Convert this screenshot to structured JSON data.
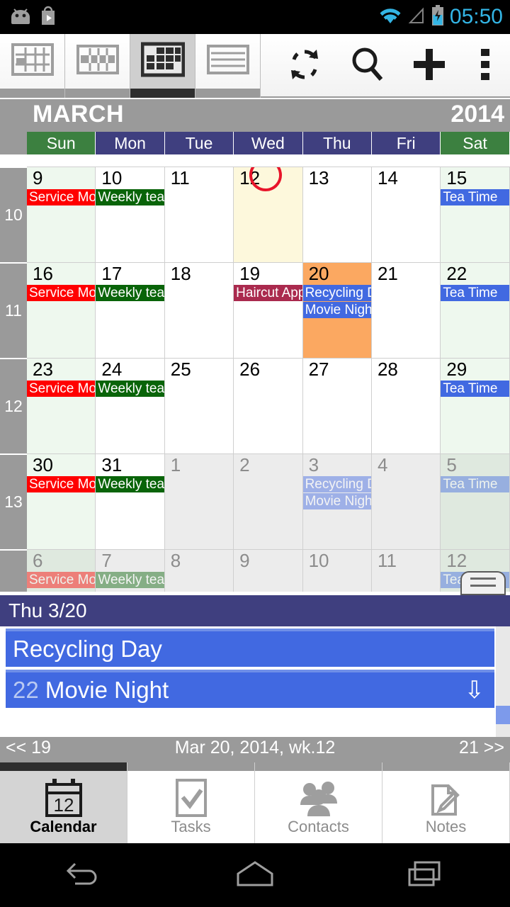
{
  "status_bar": {
    "time": "05:50",
    "icons": [
      "android-robot-icon",
      "play-store-icon",
      "wifi-icon",
      "signal-icon",
      "battery-charging-icon"
    ]
  },
  "toolbar": {
    "view_buttons": [
      {
        "name": "day-view-icon",
        "label": "Day view",
        "active": false
      },
      {
        "name": "week-view-icon",
        "label": "Week view",
        "active": false
      },
      {
        "name": "month-view-icon",
        "label": "Month view",
        "active": true
      },
      {
        "name": "agenda-view-icon",
        "label": "Agenda view",
        "active": false
      }
    ],
    "actions": [
      {
        "name": "sync-icon",
        "label": "Sync"
      },
      {
        "name": "search-icon",
        "label": "Search"
      },
      {
        "name": "add-icon",
        "label": "Add event"
      },
      {
        "name": "overflow-menu-icon",
        "label": "More options"
      }
    ]
  },
  "month_header": {
    "month": "MARCH",
    "year": "2014"
  },
  "day_headers": [
    {
      "label": "Sun",
      "weekend": true
    },
    {
      "label": "Mon",
      "weekend": false
    },
    {
      "label": "Tue",
      "weekend": false
    },
    {
      "label": "Wed",
      "weekend": false
    },
    {
      "label": "Thu",
      "weekend": false
    },
    {
      "label": "Fri",
      "weekend": false
    },
    {
      "label": "Sat",
      "weekend": true
    }
  ],
  "colors": {
    "event_red": "#ff0000",
    "event_green": "#096409",
    "event_blue": "#4169e1",
    "event_maroon": "#aa2a4e",
    "selected_day": "#fba861",
    "today_bg": "#fdf8dc",
    "today_circle": "#e8152a",
    "header_weekday": "#3f3f7f",
    "header_weekend": "#3c8040",
    "weeknum_bg": "#9a9a9a"
  },
  "weeks": [
    {
      "week_number": "10",
      "days": [
        {
          "num": "9",
          "weekend": "sun",
          "other": false,
          "today": false,
          "selected": false,
          "events": [
            {
              "title": "Service Mon",
              "color": "#ff0000"
            }
          ]
        },
        {
          "num": "10",
          "weekend": "",
          "other": false,
          "today": false,
          "selected": false,
          "events": [
            {
              "title": "Weekly tean",
              "color": "#096409"
            }
          ]
        },
        {
          "num": "11",
          "weekend": "",
          "other": false,
          "today": false,
          "selected": false,
          "events": []
        },
        {
          "num": "12",
          "weekend": "",
          "other": false,
          "today": true,
          "selected": false,
          "events": []
        },
        {
          "num": "13",
          "weekend": "",
          "other": false,
          "today": false,
          "selected": false,
          "events": []
        },
        {
          "num": "14",
          "weekend": "",
          "other": false,
          "today": false,
          "selected": false,
          "events": []
        },
        {
          "num": "15",
          "weekend": "sat",
          "other": false,
          "today": false,
          "selected": false,
          "events": [
            {
              "title": "Tea Time",
              "color": "#4169e1"
            }
          ]
        }
      ]
    },
    {
      "week_number": "11",
      "days": [
        {
          "num": "16",
          "weekend": "sun",
          "other": false,
          "today": false,
          "selected": false,
          "events": [
            {
              "title": "Service Mon",
              "color": "#ff0000"
            }
          ]
        },
        {
          "num": "17",
          "weekend": "",
          "other": false,
          "today": false,
          "selected": false,
          "events": [
            {
              "title": "Weekly tean",
              "color": "#096409"
            }
          ]
        },
        {
          "num": "18",
          "weekend": "",
          "other": false,
          "today": false,
          "selected": false,
          "events": []
        },
        {
          "num": "19",
          "weekend": "",
          "other": false,
          "today": false,
          "selected": false,
          "events": [
            {
              "title": "Haircut App",
              "color": "#aa2a4e"
            }
          ]
        },
        {
          "num": "20",
          "weekend": "",
          "other": false,
          "today": false,
          "selected": true,
          "events": [
            {
              "title": "Recycling D",
              "color": "#4169e1"
            },
            {
              "title": "Movie Night",
              "color": "#4169e1",
              "span": 2
            }
          ]
        },
        {
          "num": "21",
          "weekend": "",
          "other": false,
          "today": false,
          "selected": false,
          "events": []
        },
        {
          "num": "22",
          "weekend": "sat",
          "other": false,
          "today": false,
          "selected": false,
          "events": [
            {
              "title": "Tea Time",
              "color": "#4169e1"
            }
          ]
        }
      ]
    },
    {
      "week_number": "12",
      "days": [
        {
          "num": "23",
          "weekend": "sun",
          "other": false,
          "today": false,
          "selected": false,
          "events": [
            {
              "title": "Service Mon",
              "color": "#ff0000"
            }
          ]
        },
        {
          "num": "24",
          "weekend": "",
          "other": false,
          "today": false,
          "selected": false,
          "events": [
            {
              "title": "Weekly tean",
              "color": "#096409"
            }
          ]
        },
        {
          "num": "25",
          "weekend": "",
          "other": false,
          "today": false,
          "selected": false,
          "events": []
        },
        {
          "num": "26",
          "weekend": "",
          "other": false,
          "today": false,
          "selected": false,
          "events": []
        },
        {
          "num": "27",
          "weekend": "",
          "other": false,
          "today": false,
          "selected": false,
          "events": []
        },
        {
          "num": "28",
          "weekend": "",
          "other": false,
          "today": false,
          "selected": false,
          "events": []
        },
        {
          "num": "29",
          "weekend": "sat",
          "other": false,
          "today": false,
          "selected": false,
          "events": [
            {
              "title": "Tea Time",
              "color": "#4169e1"
            }
          ]
        }
      ]
    },
    {
      "week_number": "13",
      "days": [
        {
          "num": "30",
          "weekend": "sun",
          "other": false,
          "today": false,
          "selected": false,
          "events": [
            {
              "title": "Service Mon",
              "color": "#ff0000"
            }
          ]
        },
        {
          "num": "31",
          "weekend": "",
          "other": false,
          "today": false,
          "selected": false,
          "events": [
            {
              "title": "Weekly tean",
              "color": "#096409"
            }
          ]
        },
        {
          "num": "1",
          "weekend": "",
          "other": true,
          "today": false,
          "selected": false,
          "events": []
        },
        {
          "num": "2",
          "weekend": "",
          "other": true,
          "today": false,
          "selected": false,
          "events": []
        },
        {
          "num": "3",
          "weekend": "",
          "other": true,
          "today": false,
          "selected": false,
          "events": [
            {
              "title": "Recycling D",
              "color": "#4169e1",
              "faded": true
            },
            {
              "title": "Movie Night",
              "color": "#4169e1",
              "faded": true
            }
          ]
        },
        {
          "num": "4",
          "weekend": "",
          "other": true,
          "today": false,
          "selected": false,
          "events": []
        },
        {
          "num": "5",
          "weekend": "sat",
          "other": true,
          "today": false,
          "selected": false,
          "events": [
            {
              "title": "Tea Time",
              "color": "#4169e1",
              "faded": true
            }
          ]
        }
      ]
    },
    {
      "week_number": "",
      "short": true,
      "days": [
        {
          "num": "6",
          "weekend": "sun",
          "other": true,
          "today": false,
          "selected": false,
          "events": [
            {
              "title": "Service Mon",
              "color": "#ff0000",
              "faded": true
            }
          ]
        },
        {
          "num": "7",
          "weekend": "",
          "other": true,
          "today": false,
          "selected": false,
          "events": [
            {
              "title": "Weekly tean",
              "color": "#096409",
              "faded": true
            }
          ]
        },
        {
          "num": "8",
          "weekend": "",
          "other": true,
          "today": false,
          "selected": false,
          "events": []
        },
        {
          "num": "9",
          "weekend": "",
          "other": true,
          "today": false,
          "selected": false,
          "events": []
        },
        {
          "num": "10",
          "weekend": "",
          "other": true,
          "today": false,
          "selected": false,
          "events": []
        },
        {
          "num": "11",
          "weekend": "",
          "other": true,
          "today": false,
          "selected": false,
          "events": []
        },
        {
          "num": "12",
          "weekend": "sat",
          "other": true,
          "today": false,
          "selected": false,
          "events": [
            {
              "title": "Tea Time",
              "color": "#4169e1",
              "faded": true
            }
          ]
        }
      ]
    }
  ],
  "detail_panel": {
    "header": "Thu 3/20",
    "events": [
      {
        "count": "",
        "title": "Recycling Day",
        "has_arrow": false
      },
      {
        "count": "22",
        "title": "Movie Night",
        "has_arrow": true,
        "arrow_icon": "down-arrow-icon"
      }
    ]
  },
  "app_nav": {
    "prev": "<< 19",
    "center": "Mar 20, 2014, wk.12",
    "next": "21 >>"
  },
  "tabs": [
    {
      "label": "Calendar",
      "icon": "calendar-12-icon",
      "active": true
    },
    {
      "label": "Tasks",
      "icon": "checkbox-icon",
      "active": false
    },
    {
      "label": "Contacts",
      "icon": "people-icon",
      "active": false
    },
    {
      "label": "Notes",
      "icon": "note-edit-icon",
      "active": false
    }
  ],
  "system_nav": [
    {
      "name": "back-icon",
      "label": "Back"
    },
    {
      "name": "home-icon",
      "label": "Home"
    },
    {
      "name": "recents-icon",
      "label": "Recent apps"
    }
  ]
}
